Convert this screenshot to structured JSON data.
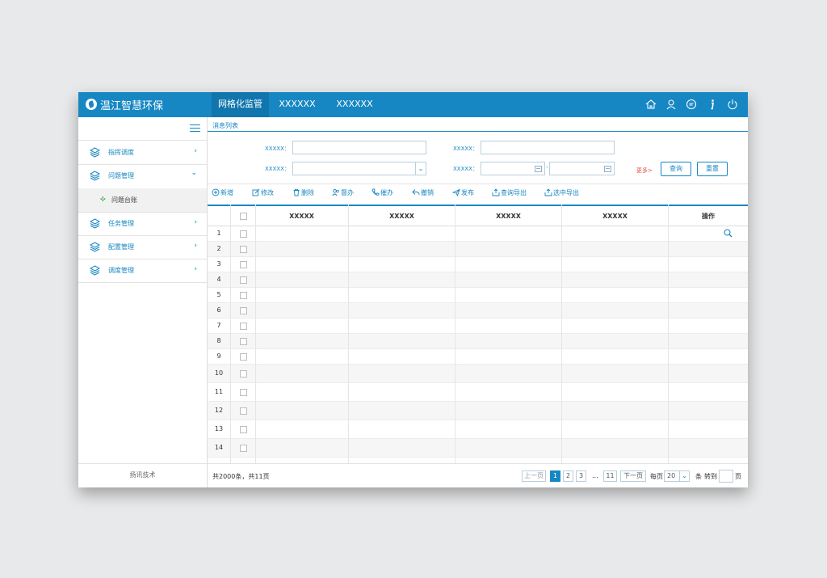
{
  "app": {
    "title": "温江智慧环保"
  },
  "topnav": {
    "tabs": [
      "网格化监管",
      "XXXXXX",
      "XXXXXX"
    ]
  },
  "topicons": [
    "home-icon",
    "user-icon",
    "message-icon",
    "info-icon",
    "power-icon"
  ],
  "sidebar": {
    "items": [
      {
        "label": "指挥调度",
        "arrow": "›"
      },
      {
        "label": "问题管理",
        "arrow": "⌄"
      },
      {
        "label": "问题台账",
        "bullet": "✣"
      },
      {
        "label": "任务管理",
        "arrow": "›"
      },
      {
        "label": "配置管理",
        "arrow": "›"
      },
      {
        "label": "调度管理",
        "arrow": "›"
      }
    ],
    "footer": "扬讯技术"
  },
  "section": {
    "title": "消息列表"
  },
  "filters": {
    "label1": "XXXXX：",
    "label2": "XXXXX：",
    "label3": "XXXXX：",
    "label4": "XXXXX：",
    "dash": "-",
    "more": "更多>",
    "query": "查询",
    "reset": "重置"
  },
  "toolbar": [
    "新增",
    "修改",
    "删除",
    "督办",
    "催办",
    "撤销",
    "发布",
    "查询导出",
    "选中导出"
  ],
  "table": {
    "headers": [
      "XXXXX",
      "XXXXX",
      "XXXXX",
      "XXXXX",
      "操作"
    ],
    "rows": [
      "1",
      "2",
      "3",
      "4",
      "5",
      "6",
      "7",
      "8",
      "9",
      "10",
      "11",
      "12",
      "13",
      "14"
    ]
  },
  "pagination": {
    "total": "共2000条，共11页",
    "prev": "上一页",
    "pages": [
      "1",
      "2",
      "3"
    ],
    "ellipsis": "...",
    "last": "11",
    "next": "下一页",
    "per_page_label": "每页",
    "per_page": "20",
    "unit": "条",
    "goto": "转到",
    "page_suffix": "页"
  },
  "colors": {
    "primary": "#1787c3",
    "more": "#e2524a"
  }
}
